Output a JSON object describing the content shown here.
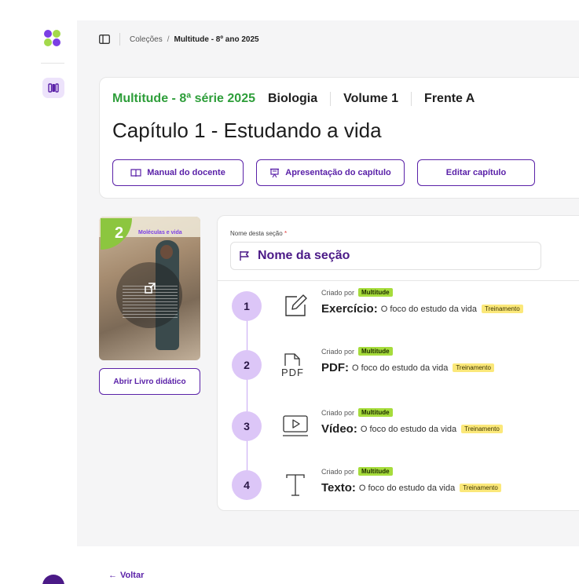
{
  "breadcrumb": {
    "root": "Coleções",
    "separator": "/",
    "current": "Multitude - 8º ano 2025"
  },
  "header": {
    "collection": "Multitude - 8ª série 2025",
    "subject": "Biologia",
    "volume": "Volume 1",
    "front": "Frente A",
    "chapter_title": "Capítulo 1 - Estudando a vida",
    "buttons": {
      "manual": "Manual do docente",
      "presentation": "Apresentação do capítulo",
      "edit": "Editar capítulo"
    }
  },
  "book": {
    "chapter_number": "2",
    "cover_title": "Moléculas e vida",
    "open_label": "Abrir Livro didático"
  },
  "section": {
    "label": "Nome desta seção",
    "required_mark": "*",
    "name": "Nome da seção",
    "items": [
      {
        "number": "1",
        "icon": "exercise-edit-icon",
        "created_by": "Criado por",
        "author": "Multitude",
        "type": "Exercício:",
        "title": "O foco do estudo da vida",
        "tag": "Treinamento"
      },
      {
        "number": "2",
        "icon": "pdf-file-icon",
        "icon_text": "PDF",
        "created_by": "Criado por",
        "author": "Multitude",
        "type": "PDF:",
        "title": "O foco do estudo da vida",
        "tag": "Treinamento"
      },
      {
        "number": "3",
        "icon": "video-play-icon",
        "created_by": "Criado por",
        "author": "Multitude",
        "type": "Vídeo:",
        "title": "O foco do estudo da vida",
        "tag": "Treinamento"
      },
      {
        "number": "4",
        "icon": "text-type-icon",
        "created_by": "Criado por",
        "author": "Multitude",
        "type": "Texto:",
        "title": "O foco do estudo da vida",
        "tag": "Treinamento"
      }
    ]
  },
  "footer": {
    "back_label": "Voltar",
    "back_arrow": "←"
  },
  "colors": {
    "brand_purple": "#5a21a8",
    "accent_green": "#2e9e3a",
    "tag_green": "#a6dc3c",
    "tag_yellow": "#fbe87a",
    "step_circle": "#dcc6f7"
  }
}
